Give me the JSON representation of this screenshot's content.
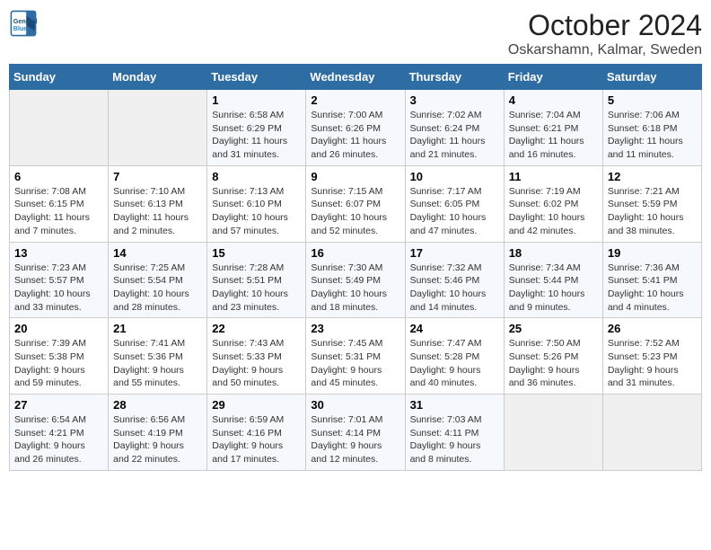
{
  "header": {
    "logo_line1": "General",
    "logo_line2": "Blue",
    "title": "October 2024",
    "subtitle": "Oskarshamn, Kalmar, Sweden"
  },
  "days_of_week": [
    "Sunday",
    "Monday",
    "Tuesday",
    "Wednesday",
    "Thursday",
    "Friday",
    "Saturday"
  ],
  "weeks": [
    [
      {
        "day": "",
        "info": ""
      },
      {
        "day": "",
        "info": ""
      },
      {
        "day": "1",
        "info": "Sunrise: 6:58 AM\nSunset: 6:29 PM\nDaylight: 11 hours and 31 minutes."
      },
      {
        "day": "2",
        "info": "Sunrise: 7:00 AM\nSunset: 6:26 PM\nDaylight: 11 hours and 26 minutes."
      },
      {
        "day": "3",
        "info": "Sunrise: 7:02 AM\nSunset: 6:24 PM\nDaylight: 11 hours and 21 minutes."
      },
      {
        "day": "4",
        "info": "Sunrise: 7:04 AM\nSunset: 6:21 PM\nDaylight: 11 hours and 16 minutes."
      },
      {
        "day": "5",
        "info": "Sunrise: 7:06 AM\nSunset: 6:18 PM\nDaylight: 11 hours and 11 minutes."
      }
    ],
    [
      {
        "day": "6",
        "info": "Sunrise: 7:08 AM\nSunset: 6:15 PM\nDaylight: 11 hours and 7 minutes."
      },
      {
        "day": "7",
        "info": "Sunrise: 7:10 AM\nSunset: 6:13 PM\nDaylight: 11 hours and 2 minutes."
      },
      {
        "day": "8",
        "info": "Sunrise: 7:13 AM\nSunset: 6:10 PM\nDaylight: 10 hours and 57 minutes."
      },
      {
        "day": "9",
        "info": "Sunrise: 7:15 AM\nSunset: 6:07 PM\nDaylight: 10 hours and 52 minutes."
      },
      {
        "day": "10",
        "info": "Sunrise: 7:17 AM\nSunset: 6:05 PM\nDaylight: 10 hours and 47 minutes."
      },
      {
        "day": "11",
        "info": "Sunrise: 7:19 AM\nSunset: 6:02 PM\nDaylight: 10 hours and 42 minutes."
      },
      {
        "day": "12",
        "info": "Sunrise: 7:21 AM\nSunset: 5:59 PM\nDaylight: 10 hours and 38 minutes."
      }
    ],
    [
      {
        "day": "13",
        "info": "Sunrise: 7:23 AM\nSunset: 5:57 PM\nDaylight: 10 hours and 33 minutes."
      },
      {
        "day": "14",
        "info": "Sunrise: 7:25 AM\nSunset: 5:54 PM\nDaylight: 10 hours and 28 minutes."
      },
      {
        "day": "15",
        "info": "Sunrise: 7:28 AM\nSunset: 5:51 PM\nDaylight: 10 hours and 23 minutes."
      },
      {
        "day": "16",
        "info": "Sunrise: 7:30 AM\nSunset: 5:49 PM\nDaylight: 10 hours and 18 minutes."
      },
      {
        "day": "17",
        "info": "Sunrise: 7:32 AM\nSunset: 5:46 PM\nDaylight: 10 hours and 14 minutes."
      },
      {
        "day": "18",
        "info": "Sunrise: 7:34 AM\nSunset: 5:44 PM\nDaylight: 10 hours and 9 minutes."
      },
      {
        "day": "19",
        "info": "Sunrise: 7:36 AM\nSunset: 5:41 PM\nDaylight: 10 hours and 4 minutes."
      }
    ],
    [
      {
        "day": "20",
        "info": "Sunrise: 7:39 AM\nSunset: 5:38 PM\nDaylight: 9 hours and 59 minutes."
      },
      {
        "day": "21",
        "info": "Sunrise: 7:41 AM\nSunset: 5:36 PM\nDaylight: 9 hours and 55 minutes."
      },
      {
        "day": "22",
        "info": "Sunrise: 7:43 AM\nSunset: 5:33 PM\nDaylight: 9 hours and 50 minutes."
      },
      {
        "day": "23",
        "info": "Sunrise: 7:45 AM\nSunset: 5:31 PM\nDaylight: 9 hours and 45 minutes."
      },
      {
        "day": "24",
        "info": "Sunrise: 7:47 AM\nSunset: 5:28 PM\nDaylight: 9 hours and 40 minutes."
      },
      {
        "day": "25",
        "info": "Sunrise: 7:50 AM\nSunset: 5:26 PM\nDaylight: 9 hours and 36 minutes."
      },
      {
        "day": "26",
        "info": "Sunrise: 7:52 AM\nSunset: 5:23 PM\nDaylight: 9 hours and 31 minutes."
      }
    ],
    [
      {
        "day": "27",
        "info": "Sunrise: 6:54 AM\nSunset: 4:21 PM\nDaylight: 9 hours and 26 minutes."
      },
      {
        "day": "28",
        "info": "Sunrise: 6:56 AM\nSunset: 4:19 PM\nDaylight: 9 hours and 22 minutes."
      },
      {
        "day": "29",
        "info": "Sunrise: 6:59 AM\nSunset: 4:16 PM\nDaylight: 9 hours and 17 minutes."
      },
      {
        "day": "30",
        "info": "Sunrise: 7:01 AM\nSunset: 4:14 PM\nDaylight: 9 hours and 12 minutes."
      },
      {
        "day": "31",
        "info": "Sunrise: 7:03 AM\nSunset: 4:11 PM\nDaylight: 9 hours and 8 minutes."
      },
      {
        "day": "",
        "info": ""
      },
      {
        "day": "",
        "info": ""
      }
    ]
  ]
}
